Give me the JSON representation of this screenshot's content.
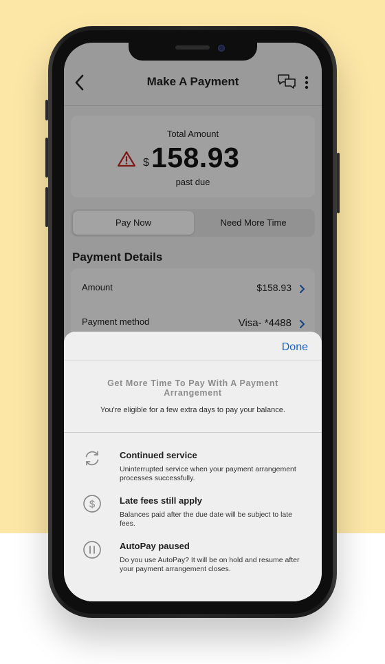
{
  "header": {
    "title": "Make A Payment",
    "back_icon": "chevron-left-icon",
    "chat_icon": "chat-bubbles-icon",
    "more_icon": "vertical-dots-icon"
  },
  "total": {
    "label": "Total Amount",
    "currency": "$",
    "amount": "158.93",
    "status": "past due",
    "warning_icon": "warning-triangle-icon",
    "warning_color": "#c62828"
  },
  "tabs": {
    "pay_now": "Pay Now",
    "need_more_time": "Need More Time",
    "selected": "Pay Now"
  },
  "details": {
    "title": "Payment Details",
    "rows": [
      {
        "label": "Amount",
        "value": "$158.93"
      },
      {
        "label": "Payment method",
        "value": "Visa- *4488"
      }
    ],
    "chevron_color": "#1f63c6"
  },
  "sheet": {
    "done_label": "Done",
    "title": "Get More Time To Pay With A Payment Arrangement",
    "subtitle": "You're eligible for a few extra days to pay your balance.",
    "features": [
      {
        "icon": "refresh-icon",
        "title": "Continued service",
        "desc": "Uninterrupted service when your payment arrangement processes successfully."
      },
      {
        "icon": "dollar-circle-icon",
        "title": "Late fees still apply",
        "desc": "Balances paid after the due date will be subject to late fees."
      },
      {
        "icon": "pause-circle-icon",
        "title": "AutoPay paused",
        "desc": "Do you use AutoPay? It will be on hold and resume after your payment arrangement closes."
      }
    ]
  },
  "colors": {
    "background": "#fde7a7",
    "accent": "#1f63c6"
  }
}
